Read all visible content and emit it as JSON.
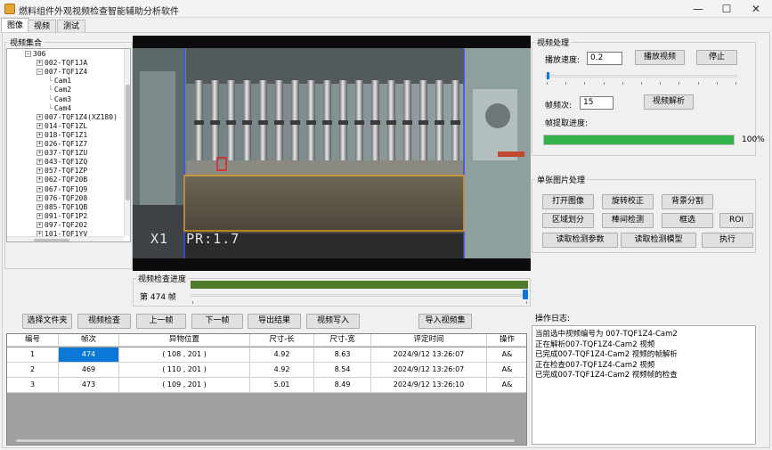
{
  "window": {
    "title": "燃料组件外观视频检查智能辅助分析软件",
    "minimize": "—",
    "maximize": "☐",
    "close": "✕"
  },
  "tabs": [
    "图像",
    "视频",
    "测试"
  ],
  "video_set": {
    "label": "视频集合",
    "tree": [
      {
        "text": "306",
        "level": 0,
        "box": "−"
      },
      {
        "text": "002-TQF1JA",
        "level": 1,
        "box": "+"
      },
      {
        "text": "007-TQF1Z4",
        "level": 1,
        "box": "−"
      },
      {
        "text": "Cam1",
        "level": 2,
        "box": ""
      },
      {
        "text": "Cam2",
        "level": 2,
        "box": ""
      },
      {
        "text": "Cam3",
        "level": 2,
        "box": ""
      },
      {
        "text": "Cam4",
        "level": 2,
        "box": ""
      },
      {
        "text": "007-TQF1Z4(XZ180)",
        "level": 1,
        "box": "+"
      },
      {
        "text": "014-TQF1ZL",
        "level": 1,
        "box": "+"
      },
      {
        "text": "018-TQF1Z1",
        "level": 1,
        "box": "+"
      },
      {
        "text": "026-TQF1Z7",
        "level": 1,
        "box": "+"
      },
      {
        "text": "037-TQF1ZU",
        "level": 1,
        "box": "+"
      },
      {
        "text": "043-TQF1ZQ",
        "level": 1,
        "box": "+"
      },
      {
        "text": "057-TQF1ZP",
        "level": 1,
        "box": "+"
      },
      {
        "text": "062-TQF20B",
        "level": 1,
        "box": "+"
      },
      {
        "text": "067-TQF1Q9",
        "level": 1,
        "box": "+"
      },
      {
        "text": "076-TQF208",
        "level": 1,
        "box": "+"
      },
      {
        "text": "085-TQF1QB",
        "level": 1,
        "box": "+"
      },
      {
        "text": "091-TQF1P2",
        "level": 1,
        "box": "+"
      },
      {
        "text": "097-TQF202",
        "level": 1,
        "box": "+"
      },
      {
        "text": "101-TQF1YV",
        "level": 1,
        "box": "+"
      }
    ]
  },
  "video_frame": {
    "overlay_text": "X1  PR:1.7"
  },
  "video_check_progress": {
    "label": "视频检查进度",
    "frame_text": "第 474 帧"
  },
  "toolbar": {
    "select_folder": "选择文件夹",
    "video_check": "视频检查",
    "prev_frame": "上一帧",
    "next_frame": "下一帧",
    "export_results": "导出结果",
    "video_write": "视频写入",
    "import_video_set": "导入视频集"
  },
  "results_table": {
    "columns": [
      "编号",
      "帧次",
      "异物位置",
      "尺寸-长",
      "尺寸-宽",
      "评定时间",
      "操作"
    ],
    "rows": [
      {
        "id": "1",
        "frame": "474",
        "pos": "( 108 , 201 )",
        "len": "4.92",
        "wid": "8.63",
        "time": "2024/9/12 13:26:07",
        "op": "A&"
      },
      {
        "id": "2",
        "frame": "469",
        "pos": "( 110 , 201 )",
        "len": "4.92",
        "wid": "8.54",
        "time": "2024/9/12 13:26:07",
        "op": "A&"
      },
      {
        "id": "3",
        "frame": "473",
        "pos": "( 109 , 201 )",
        "len": "5.01",
        "wid": "8.49",
        "time": "2024/9/12 13:26:10",
        "op": "A&"
      }
    ]
  },
  "video_processing": {
    "label": "视频处理",
    "speed_label": "播放速度:",
    "speed_value": "0.2",
    "play_button": "播放视频",
    "stop_button": "停止",
    "frame_interval_label": "帧频次:",
    "frame_interval_value": "15",
    "parse_button": "视频解析",
    "extract_progress_label": "帧提取进度:",
    "extract_progress_percent": "100%",
    "extract_progress_fraction": 1.0
  },
  "single_frame": {
    "label": "单张图片处理",
    "open_image": "打开图像",
    "rotate_correct": "旋转校正",
    "bg_segment": "背景分割",
    "region_divide": "区域划分",
    "gap_detect": "棒间检测",
    "box_select": "框选",
    "roi": "ROI",
    "read_params": "读取检测参数",
    "read_model": "读取检测模型",
    "execute": "执行"
  },
  "op_log": {
    "label": "操作日志:",
    "lines": [
      "当前选中视频编号为 007-TQF1Z4-Cam2",
      "正在解析007-TQF1Z4-Cam2 视频",
      "已完成007-TQF1Z4-Cam2 视频的帧解析",
      "正在检查007-TQF1Z4-Cam2 视频",
      "已完成007-TQF1Z4-Cam2 视频帧的检查"
    ]
  },
  "colors": {
    "progress_green": "#35b14c",
    "video_progress_green": "#4f7b2a",
    "selected_cell": "#0b78d7",
    "overlay_orange": "#e0a020",
    "overlay_blue": "#3c4fe0",
    "marker_red": "#e02020"
  }
}
